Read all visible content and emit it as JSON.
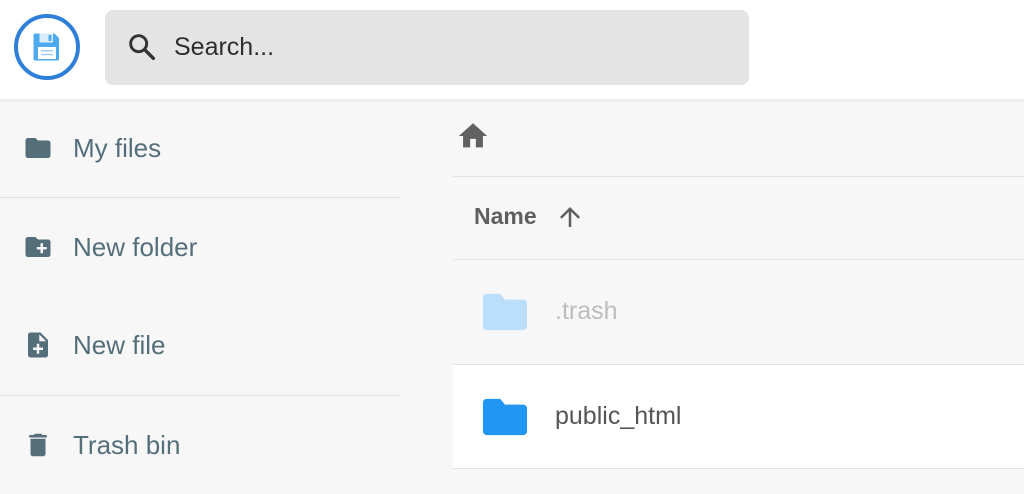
{
  "header": {
    "search": {
      "placeholder": "Search..."
    }
  },
  "sidebar": {
    "items": [
      {
        "label": "My files",
        "icon": "folder-icon"
      },
      {
        "label": "New folder",
        "icon": "folder-plus-icon"
      },
      {
        "label": "New file",
        "icon": "file-plus-icon"
      },
      {
        "label": "Trash bin",
        "icon": "trash-icon"
      }
    ]
  },
  "main": {
    "breadcrumb": {
      "icon": "home-icon"
    },
    "columns": {
      "name": "Name",
      "sort": "ascending"
    },
    "files": [
      {
        "name": ".trash",
        "type": "folder",
        "dimmed": true
      },
      {
        "name": "public_html",
        "type": "folder",
        "dimmed": false
      }
    ]
  },
  "colors": {
    "logo_ring": "#2f7fd8",
    "sidebar_text": "#546e7a",
    "folder_blue": "#2196f3",
    "folder_dimmed": "#bbdefb"
  }
}
